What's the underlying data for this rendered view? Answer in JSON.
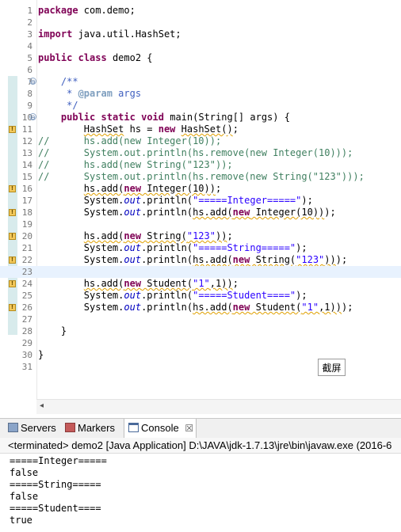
{
  "editor": {
    "lines": [
      {
        "n": "1",
        "h": "<span class=\"kw\">package</span> com.demo;"
      },
      {
        "n": "2",
        "h": ""
      },
      {
        "n": "3",
        "h": "<span class=\"kw\">import</span> java.util.HashSet;"
      },
      {
        "n": "4",
        "h": ""
      },
      {
        "n": "5",
        "h": "<span class=\"kw\">public</span> <span class=\"kw\">class</span> demo2 {"
      },
      {
        "n": "6",
        "h": ""
      },
      {
        "n": "7",
        "h": "    <span class=\"jd\">/**</span>",
        "fold": "⊖"
      },
      {
        "n": "8",
        "h": "     <span class=\"jd\">* </span><span class=\"jt\">@param</span><span class=\"jd\"> args</span>"
      },
      {
        "n": "9",
        "h": "     <span class=\"jd\">*/</span>"
      },
      {
        "n": "10",
        "h": "    <span class=\"kw\">public</span> <span class=\"kw\">static</span> <span class=\"kw\">void</span> main(String[] args) {",
        "fold": "⊖"
      },
      {
        "n": "11",
        "h": "        <span class=\"warn\">HashSet</span> hs = <span class=\"kw\">new</span> <span class=\"warn\">HashSet()</span>;",
        "warn": true
      },
      {
        "n": "12",
        "h": "<span class=\"cm\">//      hs.add(new Integer(10));</span>"
      },
      {
        "n": "13",
        "h": "<span class=\"cm\">//      System.out.println(hs.remove(new Integer(10)));</span>"
      },
      {
        "n": "14",
        "h": "<span class=\"cm\">//      hs.add(new String(\"123\"));</span>"
      },
      {
        "n": "15",
        "h": "<span class=\"cm\">//      System.out.println(hs.remove(new String(\"123\")));</span>"
      },
      {
        "n": "16",
        "h": "        <span class=\"warn\">hs.add(<span class=\"kw\">new</span> Integer(10))</span>;",
        "warn": true
      },
      {
        "n": "17",
        "h": "        System.<span class=\"it\">out</span>.println(<span class=\"st\">\"=====Integer=====\"</span>);"
      },
      {
        "n": "18",
        "h": "        System.<span class=\"it\">out</span>.println(<span class=\"warn\">hs.add(<span class=\"kw\">new</span> Integer(10))</span>);",
        "warn": true
      },
      {
        "n": "19",
        "h": ""
      },
      {
        "n": "20",
        "h": "        <span class=\"warn\">hs.add(<span class=\"kw\">new</span> String(<span class=\"st\">\"123\"</span>))</span>;",
        "warn": true
      },
      {
        "n": "21",
        "h": "        System.<span class=\"it\">out</span>.println(<span class=\"st\">\"=====String=====\"</span>);"
      },
      {
        "n": "22",
        "h": "        System.<span class=\"it\">out</span>.println(<span class=\"warn\">hs.add(<span class=\"kw\">new</span> String(<span class=\"st\">\"123\"</span>))</span>);",
        "warn": true
      },
      {
        "n": "23",
        "h": "",
        "cur": true
      },
      {
        "n": "24",
        "h": "        <span class=\"warn\">hs.add(<span class=\"kw\">new</span> Student(<span class=\"st\">\"1\"</span>,1))</span>;",
        "warn": true
      },
      {
        "n": "25",
        "h": "        System.<span class=\"it\">out</span>.println(<span class=\"st\">\"=====Student====\"</span>);"
      },
      {
        "n": "26",
        "h": "        System.<span class=\"it\">out</span>.println(<span class=\"warn\">hs.add(<span class=\"kw\">new</span> Student(<span class=\"st\">\"1\"</span>,1))</span>);",
        "warn": true
      },
      {
        "n": "27",
        "h": ""
      },
      {
        "n": "28",
        "h": "    }"
      },
      {
        "n": "29",
        "h": ""
      },
      {
        "n": "30",
        "h": "}"
      },
      {
        "n": "31",
        "h": ""
      }
    ],
    "screenshot_button": "截屏"
  },
  "views": {
    "tabs": [
      {
        "label": "Servers",
        "icon": "servers-icon"
      },
      {
        "label": "Markers",
        "icon": "markers-icon"
      },
      {
        "label": "Console",
        "icon": "console-icon",
        "close": "☒"
      }
    ]
  },
  "console": {
    "header": "<terminated> demo2 [Java Application] D:\\JAVA\\jdk-1.7.13\\jre\\bin\\javaw.exe (2016-6",
    "output": [
      "=====Integer=====",
      "false",
      "=====String=====",
      "false",
      "=====Student====",
      "true"
    ]
  },
  "colors": {
    "keyword": "#7f0055",
    "comment": "#3f7f5f",
    "javadoc": "#3f5fbf",
    "string": "#2a00ff",
    "field": "#0000c0",
    "warning": "#e0a000"
  }
}
